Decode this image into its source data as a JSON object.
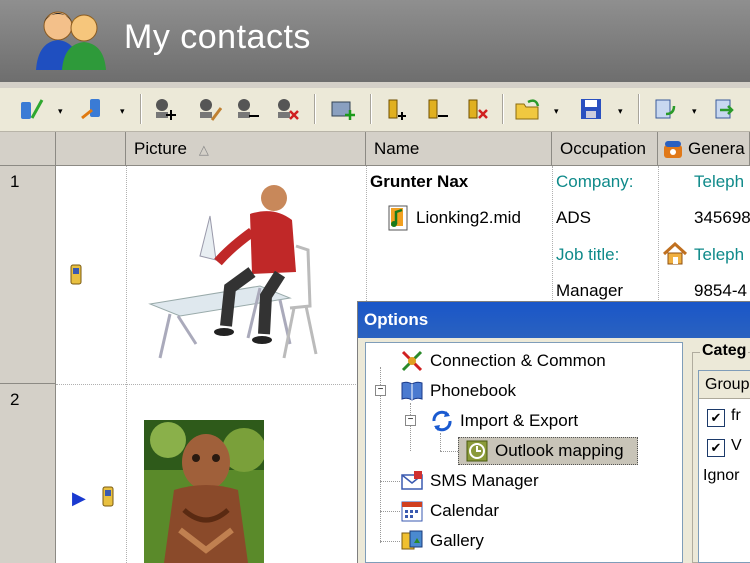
{
  "app": {
    "title": "My contacts"
  },
  "toolbar": {
    "drop_symbol": "▾"
  },
  "grid": {
    "columns": [
      {
        "label": ""
      },
      {
        "label": "Picture"
      },
      {
        "label": "Name"
      },
      {
        "label": "Occupation"
      },
      {
        "label": "Genera"
      }
    ],
    "sort_arrow": "△",
    "rows": [
      {
        "number": "1",
        "name": "Grunter Nax",
        "attachment": "Lionking2.mid",
        "company_label": "Company:",
        "company_value": "ADS",
        "jobtitle_label": "Job title:",
        "jobtitle_value": "Manager",
        "phone1_label": "Teleph",
        "phone1_value": "345698",
        "phone2_label": "Teleph",
        "phone2_value": "9854-4"
      },
      {
        "number": "2",
        "row_marker": "▶"
      }
    ]
  },
  "options_dialog": {
    "title": "Options",
    "tree": [
      {
        "label": "Connection & Common"
      },
      {
        "label": "Phonebook",
        "expander": "−"
      },
      {
        "label": "Import & Export",
        "expander": "−"
      },
      {
        "label": "Outlook mapping",
        "selected": true
      },
      {
        "label": "SMS Manager"
      },
      {
        "label": "Calendar"
      },
      {
        "label": "Gallery"
      }
    ],
    "categories": {
      "group_label": "Categ",
      "column_header": "Group",
      "items": [
        {
          "label": "fr",
          "checked": true
        },
        {
          "label": "V",
          "checked": true
        }
      ],
      "ignore_label": "Ignor"
    }
  },
  "colors": {
    "accent_teal": "#0f8a8a",
    "dialog_title": "#1a56c8"
  }
}
